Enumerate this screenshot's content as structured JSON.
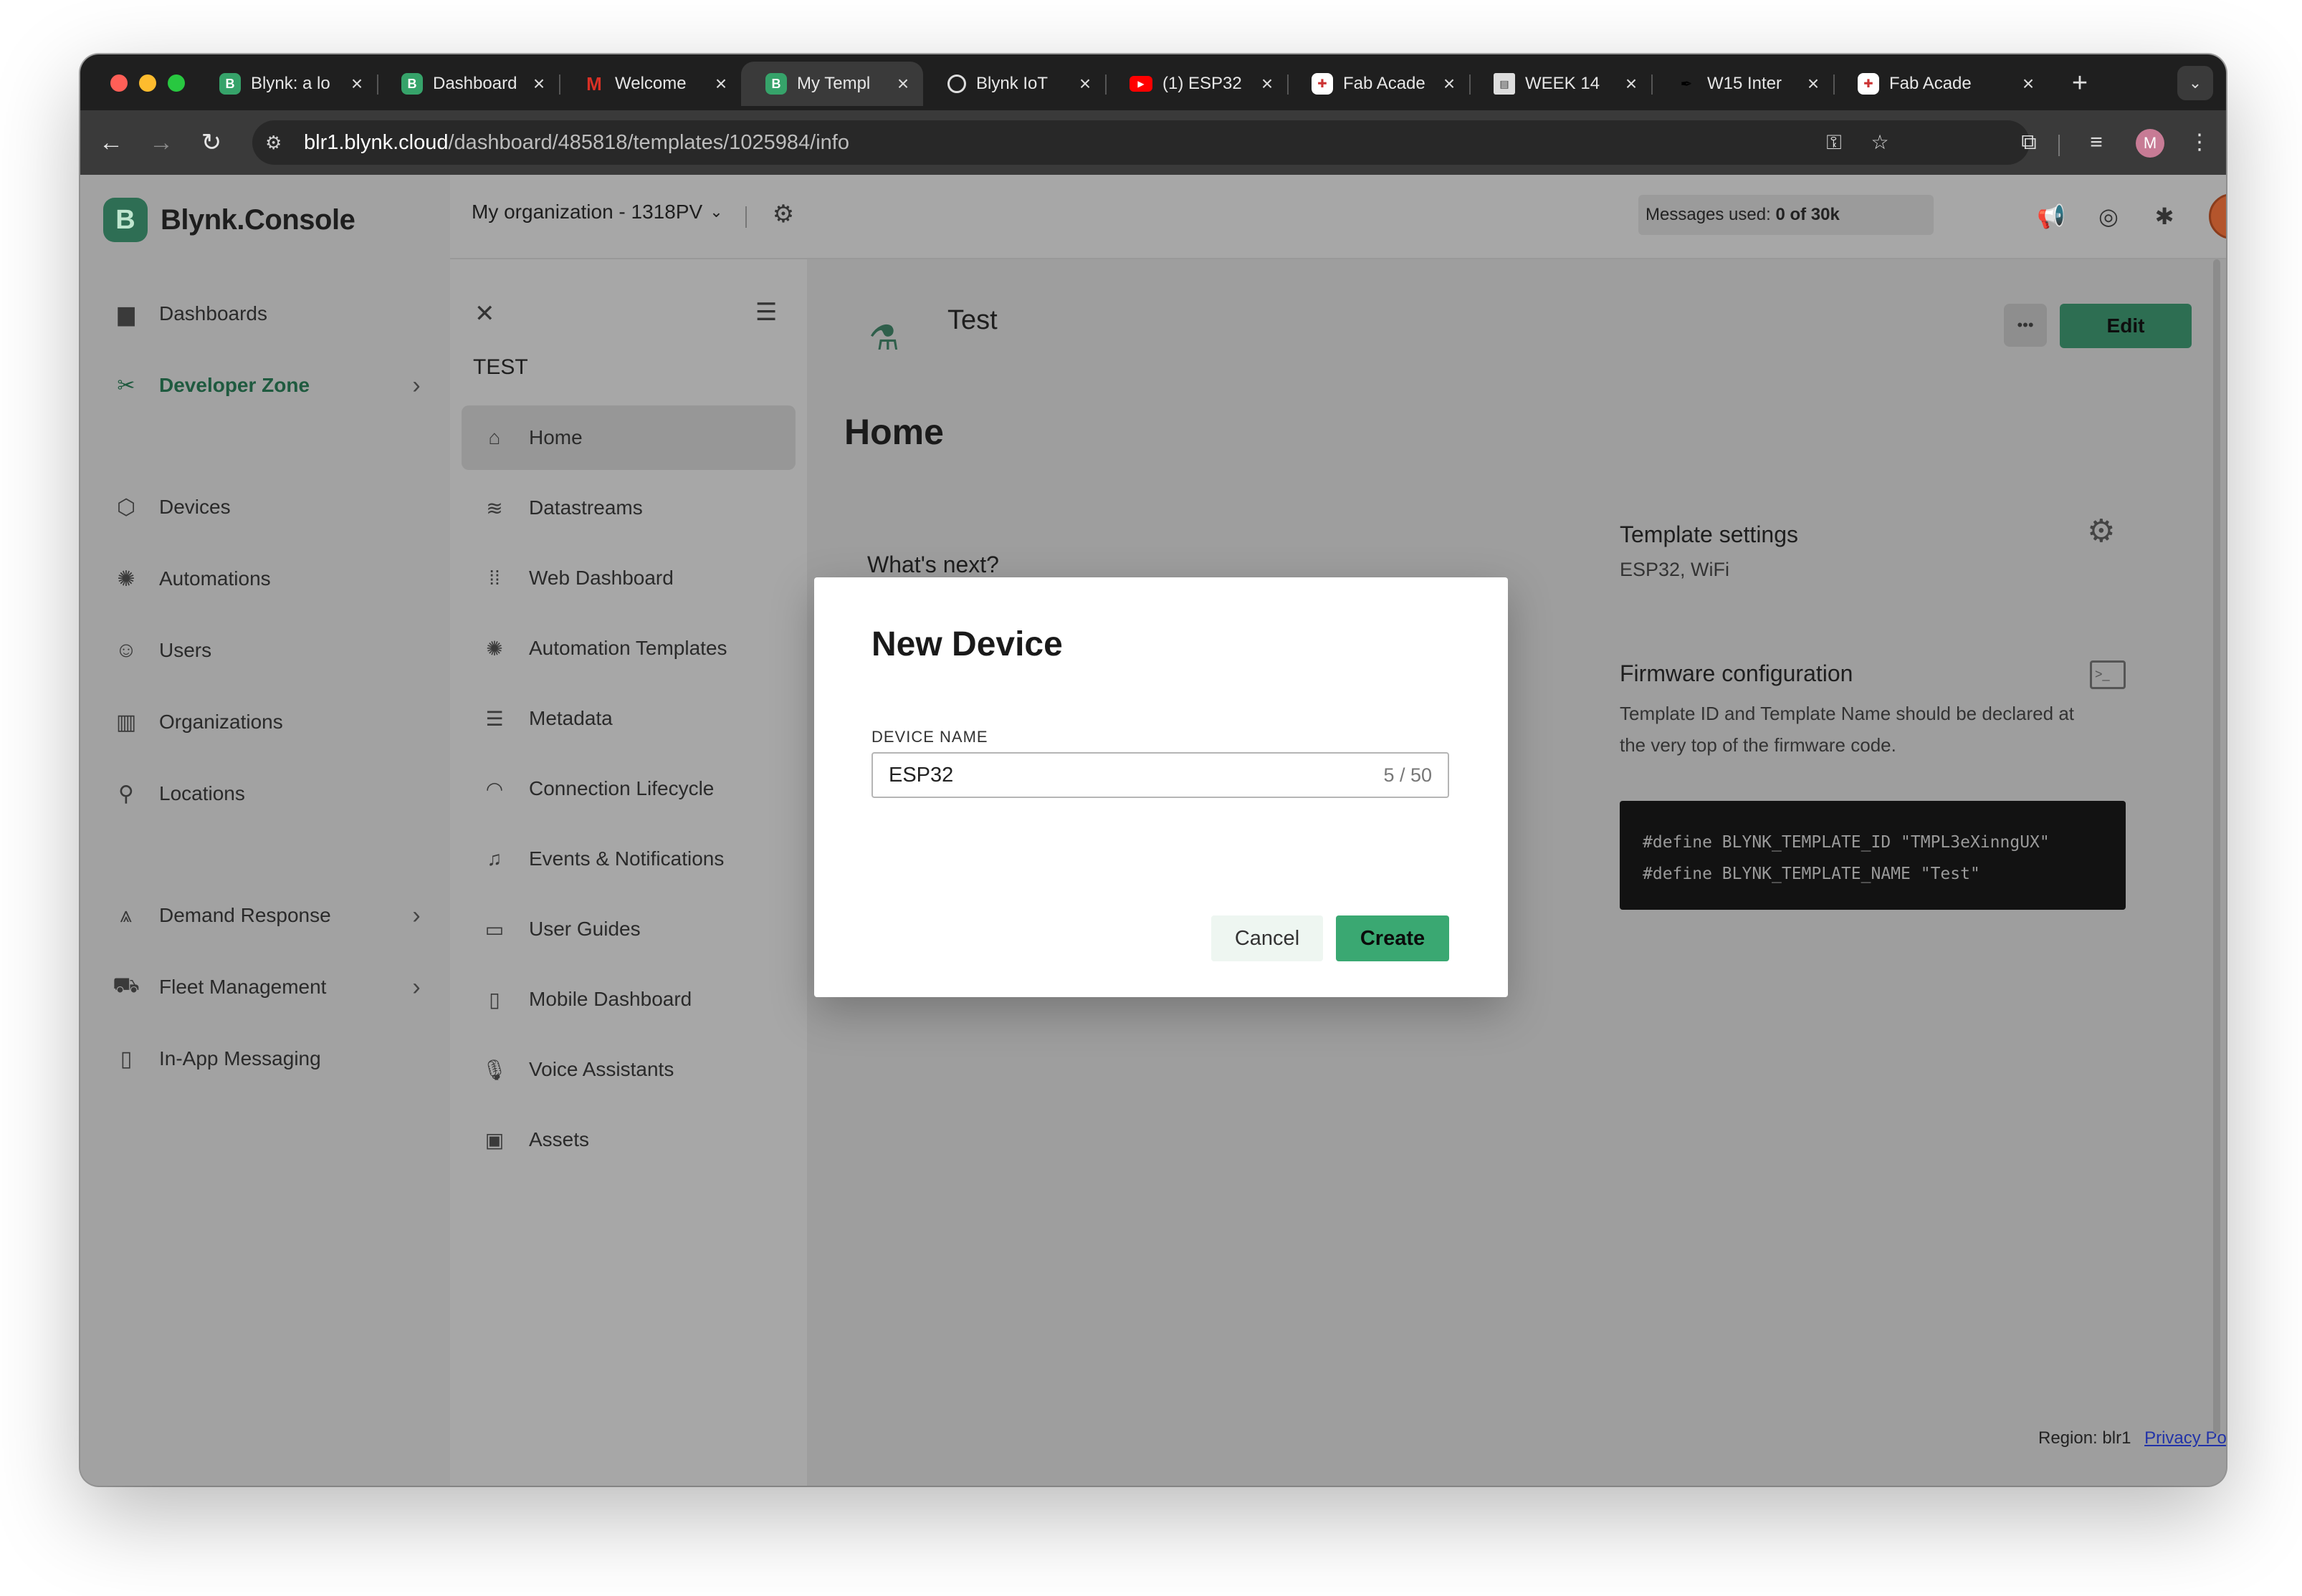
{
  "browser": {
    "tabs": [
      {
        "title": "Blynk: a lo",
        "favicon": "blynk-b",
        "color": "#36a36a"
      },
      {
        "title": "Dashboard",
        "favicon": "blynk-b",
        "color": "#36a36a"
      },
      {
        "title": "Welcome",
        "favicon": "gmail-m",
        "color": "#d93025"
      },
      {
        "title": "My Templ",
        "favicon": "blynk-b",
        "color": "#36a36a",
        "active": true
      },
      {
        "title": "Blynk IoT",
        "favicon": "globe",
        "color": "#888888"
      },
      {
        "title": "(1) ESP32",
        "favicon": "youtube",
        "color": "#ff0000"
      },
      {
        "title": "Fab Acade",
        "favicon": "fab-academy",
        "color": "#cc3333"
      },
      {
        "title": "WEEK 14",
        "favicon": "page",
        "color": "#cccccc"
      },
      {
        "title": "W15 Inter",
        "favicon": "feather",
        "color": "#111111"
      },
      {
        "title": "Fab Acade",
        "favicon": "fab-academy",
        "color": "#cc3333"
      }
    ],
    "url_host": "blr1.blynk.cloud",
    "url_path": "/dashboard/485818/templates/1025984/info",
    "profile_initial": "M"
  },
  "app": {
    "brand": "Blynk.Console",
    "brand_logo": "B",
    "org_name": "My organization - 1318PV",
    "messages_label": "Messages used:",
    "messages_value": "0 of 30k"
  },
  "sidebar": {
    "items": [
      {
        "label": "Dashboards",
        "icon": "bar-chart-icon"
      },
      {
        "label": "Developer Zone",
        "icon": "tools-icon",
        "has_chevron": true,
        "highlight": true
      },
      {
        "label": "Devices",
        "icon": "cube-icon"
      },
      {
        "label": "Automations",
        "icon": "automation-icon"
      },
      {
        "label": "Users",
        "icon": "users-icon"
      },
      {
        "label": "Organizations",
        "icon": "building-icon"
      },
      {
        "label": "Locations",
        "icon": "location-pin-icon"
      },
      {
        "label": "Demand Response",
        "icon": "demand-icon",
        "has_chevron": true
      },
      {
        "label": "Fleet Management",
        "icon": "truck-icon",
        "has_chevron": true
      },
      {
        "label": "In-App Messaging",
        "icon": "message-icon"
      }
    ]
  },
  "subnav": {
    "template_name": "TEST",
    "items": [
      {
        "label": "Home",
        "icon": "home-icon",
        "active": true
      },
      {
        "label": "Datastreams",
        "icon": "datastreams-icon"
      },
      {
        "label": "Web Dashboard",
        "icon": "grid-icon"
      },
      {
        "label": "Automation Templates",
        "icon": "automation-icon"
      },
      {
        "label": "Metadata",
        "icon": "list-icon"
      },
      {
        "label": "Connection Lifecycle",
        "icon": "wifi-icon"
      },
      {
        "label": "Events & Notifications",
        "icon": "bell-icon"
      },
      {
        "label": "User Guides",
        "icon": "book-icon"
      },
      {
        "label": "Mobile Dashboard",
        "icon": "phone-icon"
      },
      {
        "label": "Voice Assistants",
        "icon": "microphone-icon"
      },
      {
        "label": "Assets",
        "icon": "assets-icon"
      }
    ]
  },
  "main": {
    "template_title": "Test",
    "edit_label": "Edit",
    "page_title": "Home",
    "whats_next": "What's next?",
    "template_settings": {
      "title": "Template settings",
      "subtitle": "ESP32, WiFi"
    },
    "firmware": {
      "title": "Firmware configuration",
      "description": "Template ID and Template Name should be declared at the very top of the firmware code.",
      "code_line_1": "#define BLYNK_TEMPLATE_ID \"TMPL3eXinngUX\"",
      "code_line_2": "#define BLYNK_TEMPLATE_NAME \"Test\""
    },
    "footer": {
      "region": "Region: blr1",
      "privacy": "Privacy Policy"
    }
  },
  "modal": {
    "title": "New Device",
    "field_label": "DEVICE NAME",
    "field_value": "ESP32",
    "char_count": "5 / 50",
    "cancel_label": "Cancel",
    "create_label": "Create",
    "create_color": "#3aa872"
  }
}
